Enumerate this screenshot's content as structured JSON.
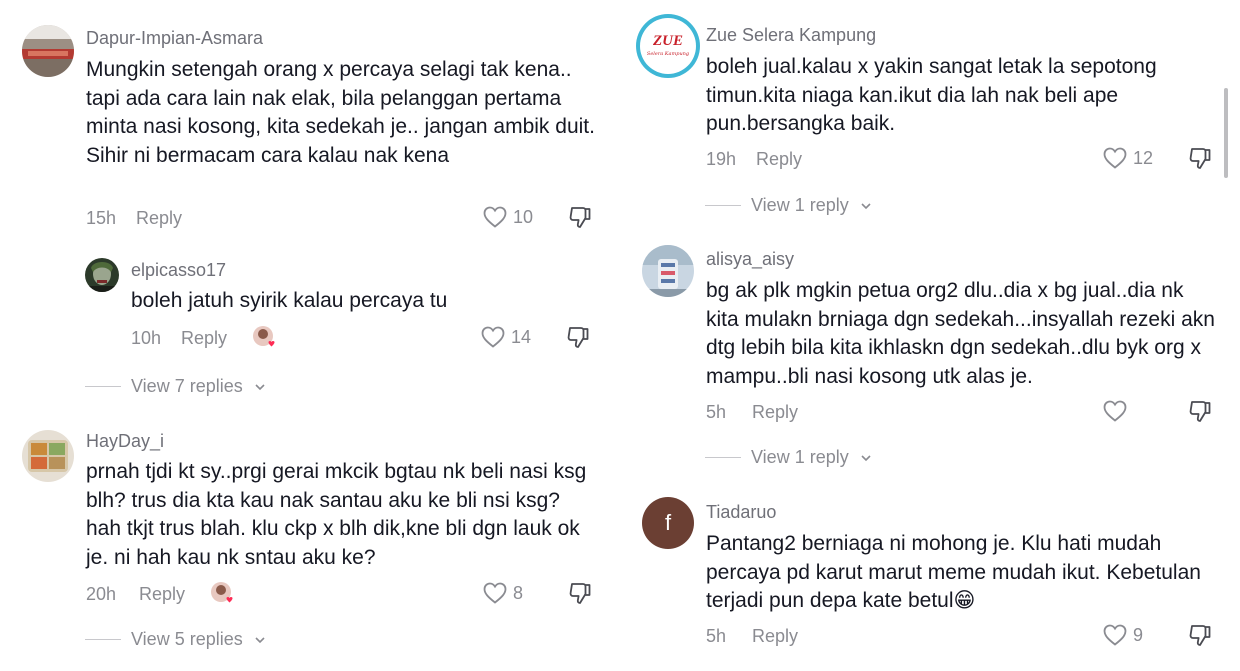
{
  "left": {
    "c1": {
      "username": "Dapur-Impian-Asmara",
      "text": "Mungkin setengah orang x percaya selagi tak kena.. tapi ada cara lain nak elak, bila pelanggan pertama minta nasi kosong, kita sedekah je.. jangan ambik duit. Sihir ni bermacam cara kalau nak kena",
      "time": "15h",
      "reply_label": "Reply",
      "likes": "10"
    },
    "r1": {
      "username": "elpicasso17",
      "text": "boleh jatuh syirik kalau percaya tu",
      "time": "10h",
      "reply_label": "Reply",
      "likes": "14"
    },
    "view1": "View 7 replies",
    "c2": {
      "username": "HayDay_i",
      "text": "prnah tjdi kt sy..prgi gerai mkcik bgtau nk beli nasi ksg blh? trus dia kta kau nak santau aku ke bli nsi ksg? hah tkjt trus blah. klu ckp x blh dik,kne bli dgn lauk ok je. ni hah kau nk sntau aku ke?",
      "time": "20h",
      "reply_label": "Reply",
      "likes": "8"
    },
    "view2": "View 5 replies"
  },
  "right": {
    "c1": {
      "username": "Zue Selera Kampung",
      "avatar_text": "ZUE",
      "avatar_sub": "Selera Kampung",
      "text": "boleh jual.kalau x yakin sangat letak la sepotong timun.kita niaga kan.ikut dia lah nak beli ape pun.bersangka baik.",
      "time": "19h",
      "reply_label": "Reply",
      "likes": "12"
    },
    "view1": "View 1 reply",
    "c2": {
      "username": "alisya_aisy",
      "text": "bg ak plk mgkin petua org2 dlu..dia x bg jual..dia nk kita mulakn brniaga dgn sedekah...insyallah rezeki akn dtg lebih bila kita ikhlaskn dgn sedekah..dlu byk org x mampu..bli nasi kosong utk alas je.",
      "time": "5h",
      "reply_label": "Reply"
    },
    "view2": "View 1 reply",
    "c3": {
      "username": "Tiadaruo",
      "avatar_letter": "f",
      "text": "Pantang2 berniaga ni mohong je. Klu hati mudah percaya pd karut marut meme mudah ikut. Kebetulan terjadi pun depa kate betul",
      "emoji": "😁",
      "time": "5h",
      "reply_label": "Reply",
      "likes": "9"
    }
  },
  "colors": {
    "text": "#161823",
    "muted": "#8a8b91",
    "username": "#6f7078",
    "avatar_f_bg": "#6b3f33",
    "like_heart": "#fe2c55"
  },
  "icons": [
    "heart-outline-icon",
    "dislike-icon",
    "chevron-down-icon",
    "liked-by-creator-badge"
  ]
}
